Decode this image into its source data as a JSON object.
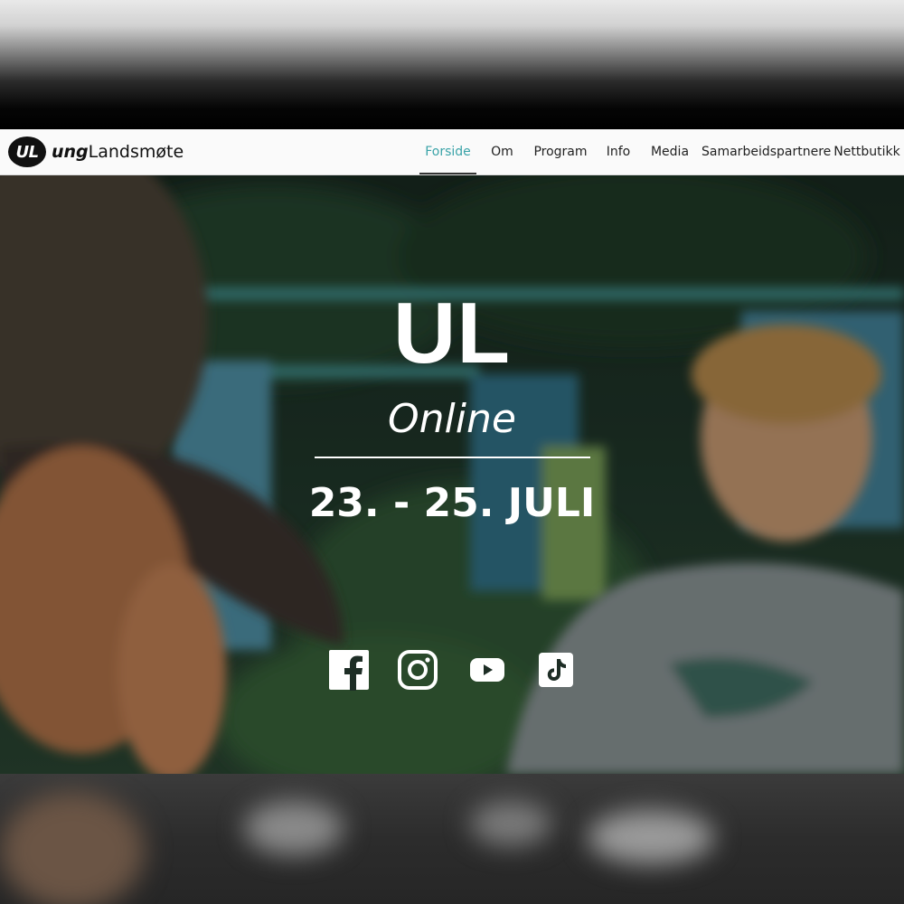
{
  "brand": {
    "badge": "UL",
    "name_bold": "ung",
    "name_rest": "Landsmøte"
  },
  "nav": {
    "items": [
      {
        "label": "Forside",
        "active": true
      },
      {
        "label": "Om",
        "active": false
      },
      {
        "label": "Program",
        "active": false
      },
      {
        "label": "Info",
        "active": false
      },
      {
        "label": "Media",
        "active": false
      },
      {
        "label": "Samarbeidspartnere",
        "active": false
      },
      {
        "label": "Nettbutikk",
        "active": false
      }
    ],
    "active_color": "#3aa3a8"
  },
  "hero": {
    "title": "UL",
    "subtitle": "Online",
    "date": "23. - 25. JULI"
  },
  "social": [
    {
      "icon": "facebook-icon"
    },
    {
      "icon": "instagram-icon"
    },
    {
      "icon": "youtube-icon"
    },
    {
      "icon": "tiktok-icon"
    }
  ]
}
